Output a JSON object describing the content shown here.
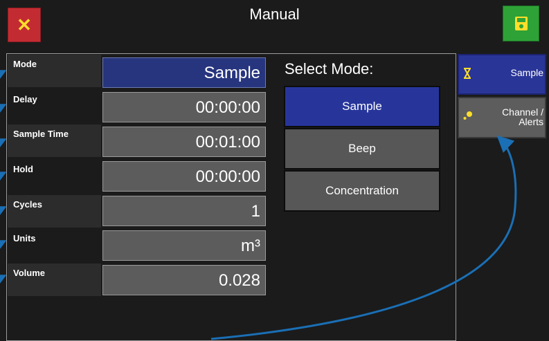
{
  "header": {
    "title": "Manual"
  },
  "fields": [
    {
      "label": "Mode",
      "value": "Sample"
    },
    {
      "label": "Delay",
      "value": "00:00:00"
    },
    {
      "label": "Sample Time",
      "value": "00:01:00"
    },
    {
      "label": "Hold",
      "value": "00:00:00"
    },
    {
      "label": "Cycles",
      "value": "1"
    },
    {
      "label": "Units",
      "value": "m³"
    },
    {
      "label": "Volume",
      "value": "0.028"
    }
  ],
  "select_mode": {
    "title": "Select Mode:",
    "options": [
      "Sample",
      "Beep",
      "Concentration"
    ],
    "selected": "Sample"
  },
  "side_tabs": [
    {
      "label": "Sample",
      "icon": "hourglass-icon",
      "active": true
    },
    {
      "label_line1": "Channel /",
      "label_line2": "Alerts",
      "icon": "dots-icon",
      "active": false
    }
  ],
  "colors": {
    "close_button": "#c32b33",
    "close_icon": "#ffde2a",
    "save_button": "#2ea236",
    "selected_blue": "#27359b",
    "annotation_blue": "#1a6fb5"
  }
}
